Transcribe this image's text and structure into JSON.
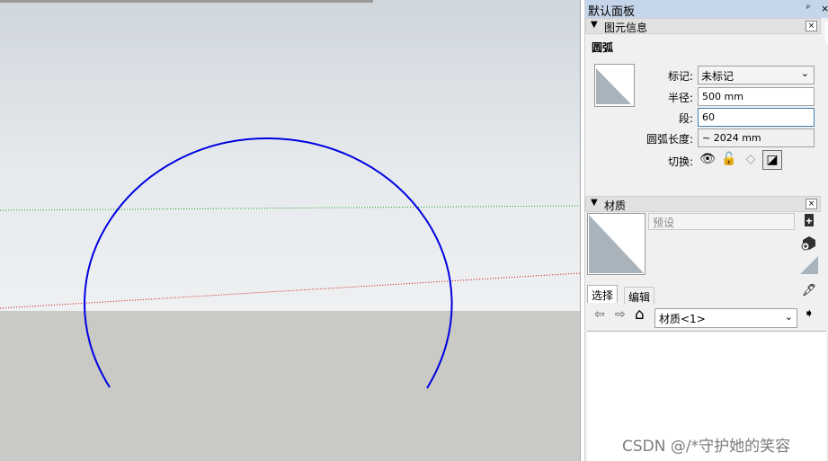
{
  "panel": {
    "title": "默认面板",
    "pin_glyph": "ᵖ",
    "close_glyph": "×"
  },
  "entity_info": {
    "section_title": "图元信息",
    "collapse_glyph": "▼",
    "close_glyph": "×",
    "entity_type": "圆弧",
    "tag_label": "标记:",
    "tag_value": "未标记",
    "radius_label": "半径:",
    "radius_value": "500 mm",
    "segments_label": "段:",
    "segments_value": "60",
    "arc_length_label": "圆弧长度:",
    "arc_length_value": "~ 2024 mm",
    "toggles_label": "切换:",
    "toggles": [
      {
        "icon": "eye-icon",
        "glyph": "👁"
      },
      {
        "icon": "lock-icon",
        "glyph": "🔓"
      },
      {
        "icon": "receive-shadows-icon",
        "glyph": "◇"
      },
      {
        "icon": "cast-shadows-icon",
        "glyph": "◪"
      }
    ]
  },
  "materials": {
    "section_title": "材质",
    "collapse_glyph": "▼",
    "close_glyph": "×",
    "preset_placeholder": "预设",
    "tab_select": "选择",
    "tab_edit": "编辑",
    "current_material": "材质<1>",
    "swatch_color": "#a8b3bc",
    "nav_back_glyph": "⇦",
    "nav_forward_glyph": "⇨",
    "nav_home_glyph": "⌂",
    "nav_details_glyph": "➧",
    "eyedropper_glyph": "🖋"
  },
  "viewport": {
    "arc_color": "#0000e0",
    "green_axis_color": "#1a9a1a",
    "red_axis_color": "#d00000",
    "sky_color": "#dfe3e7",
    "ground_color": "#c9c9c6"
  },
  "watermark": "CSDN @/*守护她的笑容"
}
